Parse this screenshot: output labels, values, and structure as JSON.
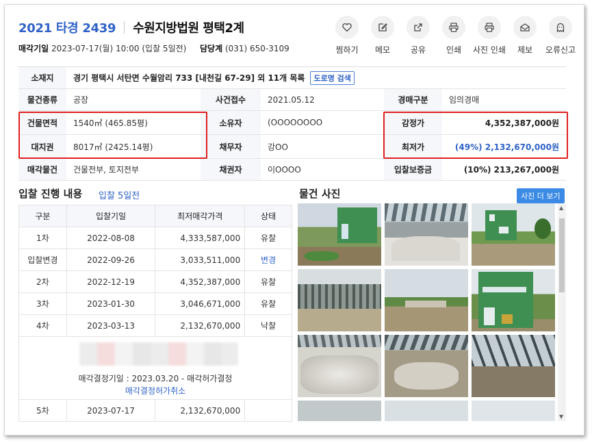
{
  "header": {
    "case_no": "2021 타경 2439",
    "court": "수원지방법원 평택2계",
    "sale_date_label": "매각기일",
    "sale_date": "2023-07-17(월) 10:00 (입찰 5일전)",
    "dept_label": "담당계",
    "dept_phone": "(031) 650-3109"
  },
  "actions": [
    {
      "label": "찜하기",
      "icon": "heart-icon"
    },
    {
      "label": "메모",
      "icon": "memo-icon"
    },
    {
      "label": "공유",
      "icon": "share-icon"
    },
    {
      "label": "인쇄",
      "icon": "print-icon"
    },
    {
      "label": "사진 인쇄",
      "icon": "print-icon"
    },
    {
      "label": "제보",
      "icon": "report-mail-icon"
    },
    {
      "label": "오류신고",
      "icon": "ghost-icon"
    }
  ],
  "info": {
    "location_label": "소재지",
    "location": "경기 평택시 서탄면 수월암리 733 [내천길 67-29] 외 11개 목록",
    "road_btn": "도로명 검색",
    "type_label": "물건종류",
    "type": "공장",
    "received_label": "사건접수",
    "received": "2021.05.12",
    "auction_kind_label": "경매구분",
    "auction_kind": "임의경매",
    "building_label": "건물면적",
    "building": "1540㎡ (465.85평)",
    "owner_label": "소유자",
    "owner": "(OOOOOOOO",
    "appraisal_label": "감정가",
    "appraisal": "4,352,387,000원",
    "land_label": "대지권",
    "land": "8017㎡ (2425.14평)",
    "debtor_label": "채무자",
    "debtor": "강OO",
    "min_label": "최저가",
    "min": "(49%) 2,132,670,000원",
    "sale_items_label": "매각물건",
    "sale_items": "건물전부, 토지전부",
    "creditor_label": "채권자",
    "creditor": "이OOOO",
    "deposit_label": "입찰보증금",
    "deposit": "(10%) 213,267,000원"
  },
  "bid": {
    "title": "입찰 진행 내용",
    "subtitle": "입찰 5일전",
    "headers": [
      "구분",
      "입찰기일",
      "최저매각가격",
      "상태"
    ],
    "rows": [
      {
        "round": "1차",
        "date": "2022-08-08",
        "price": "4,333,587,000",
        "status": "유찰"
      },
      {
        "round": "입찰변경",
        "date": "2022-09-26",
        "price": "3,033,511,000",
        "status": "변경"
      },
      {
        "round": "2차",
        "date": "2022-12-19",
        "price": "4,352,387,000",
        "status": "유찰"
      },
      {
        "round": "3차",
        "date": "2023-01-30",
        "price": "3,046,671,000",
        "status": "유찰"
      },
      {
        "round": "4차",
        "date": "2023-03-13",
        "price": "2,132,670,000",
        "status": "낙찰"
      }
    ],
    "decision_note": "매각결정기일 : 2023.03.20 - 매각허가결정",
    "decision_link": "매각결정허가취소",
    "last_row": {
      "round": "5차",
      "date": "2023-07-17",
      "price": "2,132,670,000",
      "status": ""
    }
  },
  "photos": {
    "title": "물건 사진",
    "more_btn": "사진 더 보기"
  },
  "colors": {
    "accent": "#2f62c8",
    "highlight": "#e01e1e",
    "button": "#3a8ae6"
  }
}
